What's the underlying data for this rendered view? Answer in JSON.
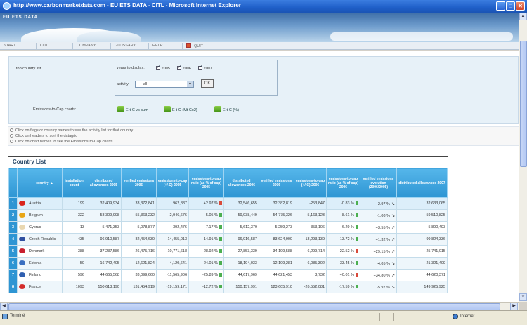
{
  "window": {
    "title": "http://www.carbonmarketdata.com - EU ETS DATA - CITL - Microsoft Internet Explorer",
    "minimize": "_",
    "maximize": "□",
    "close": "✕"
  },
  "banner": {
    "logo": "EU ETS DATA"
  },
  "menu": [
    "START",
    "CITL",
    "COMPANY",
    "GLOSSARY",
    "HELP",
    "QUIT"
  ],
  "filter": {
    "label": "top country list",
    "years_label": "years to display:",
    "years": [
      "2005",
      "2006",
      "2007"
    ],
    "activity_label": "activity",
    "activity_value": "---- all ----",
    "ok_label": "OK",
    "charts_label": "Emissions-to-Cap charts:",
    "chart_links": [
      "E-t-C vs sum",
      "E-t-C (Mt Co2)",
      "E-t-C (%)"
    ]
  },
  "hints": [
    "Click on flags or country names to see the activity list for that country",
    "Click on headers to sort the datagrid",
    "Click on chart names to see the Emissions-to-Cap charts"
  ],
  "section_title": "Country List",
  "table": {
    "headers": [
      "",
      "",
      "country ▲",
      "installation count",
      "distributed allowances 2005",
      "verified emissions 2005",
      "emissions-to-cap (+/-C) 2005",
      "emissions-to-cap ratio (as % of cap) 2005",
      "distributed allowances 2006",
      "verified emissions 2006",
      "emissions-to-cap (+/-C) 2006",
      "emissions-to-cap ratio (as % of cap) 2006",
      "verified emissions evolution (2006/2005)",
      "distributed allowances 2007"
    ],
    "rows": [
      {
        "rank": "1",
        "country": "Austria",
        "count": "199",
        "da05": "32,409,934",
        "ve05": "33,372,841",
        "etc05": "962,887",
        "r05": "+2.97 %",
        "da06": "32,546,655",
        "ve06": "32,382,819",
        "etc06": "-253,847",
        "r06": "-0.83 %",
        "evo": "-2.97 %",
        "evo_dir": "down",
        "da07": "32,633,065",
        "flag": "#d9241c",
        "r05c": "#d94a3a",
        "r06c": "#4caf50"
      },
      {
        "rank": "2",
        "country": "Belgium",
        "count": "322",
        "da05": "58,309,998",
        "ve05": "55,363,232",
        "etc05": "-2,946,676",
        "r05": "-5.05 %",
        "da06": "59,938,449",
        "ve06": "54,775,326",
        "etc06": "-5,163,123",
        "r06": "-8.61 %",
        "evo": "-1.08 %",
        "evo_dir": "down",
        "da07": "59,510,825",
        "flag": "#e8a515",
        "r05c": "#4caf50",
        "r06c": "#4caf50"
      },
      {
        "rank": "3",
        "country": "Cyprus",
        "count": "13",
        "da05": "5,471,353",
        "ve05": "5,078,877",
        "etc05": "-392,476",
        "r05": "-7.17 %",
        "da06": "5,612,379",
        "ve06": "5,259,273",
        "etc06": "-353,106",
        "r06": "-6.29 %",
        "evo": "+3.55 %",
        "evo_dir": "up",
        "da07": "5,890,493",
        "flag": "#e9d7b0",
        "r05c": "#4caf50",
        "r06c": "#4caf50"
      },
      {
        "rank": "4",
        "country": "Czech Republic",
        "count": "435",
        "da05": "96,910,587",
        "ve05": "82,454,630",
        "etc05": "-14,455,013",
        "r05": "-14.91 %",
        "da06": "96,916,587",
        "ve06": "83,624,900",
        "etc06": "-13,293,139",
        "r06": "-13.72 %",
        "evo": "+1.32 %",
        "evo_dir": "up",
        "da07": "99,824,336",
        "flag": "#2f4fa0",
        "r05c": "#4caf50",
        "r06c": "#4caf50"
      },
      {
        "rank": "5",
        "country": "Denmark",
        "count": "388",
        "da05": "37,237,586",
        "ve05": "26,475,716",
        "etc05": "-10,771,618",
        "r05": "-28.92 %",
        "da06": "27,853,339",
        "ve06": "34,199,588",
        "etc06": "6,299,714",
        "r06": "+22.52 %",
        "evo": "+29.15 %",
        "evo_dir": "up",
        "da07": "25,741,015",
        "flag": "#c8202f",
        "r05c": "#4caf50",
        "r06c": "#d94a3a"
      },
      {
        "rank": "6",
        "country": "Estonia",
        "count": "50",
        "da05": "16,742,405",
        "ve05": "12,621,824",
        "etc05": "-4,120,641",
        "r05": "-24.01 %",
        "da06": "18,194,033",
        "ve06": "12,109,281",
        "etc06": "-6,085,302",
        "r06": "-33.45 %",
        "evo": "-4.05 %",
        "evo_dir": "down",
        "da07": "21,321,409",
        "flag": "#3a6fc0",
        "r05c": "#4caf50",
        "r06c": "#4caf50"
      },
      {
        "rank": "7",
        "country": "Finland",
        "count": "596",
        "da05": "44,665,568",
        "ve05": "33,099,660",
        "etc05": "-11,565,906",
        "r05": "-25.89 %",
        "da06": "44,617,969",
        "ve06": "44,621,453",
        "etc06": "3,732",
        "r06": "+0.01 %",
        "evo": "+34.80 %",
        "evo_dir": "up",
        "da07": "44,620,371",
        "flag": "#2f5fb0",
        "r05c": "#4caf50",
        "r06c": "#d94a3a"
      },
      {
        "rank": "8",
        "country": "France",
        "count": "1093",
        "da05": "150,613,190",
        "ve05": "131,454,919",
        "etc05": "-19,159,171",
        "r05": "-12.72 %",
        "da06": "150,157,991",
        "ve06": "123,605,910",
        "etc06": "-26,552,081",
        "r06": "-17.59 %",
        "evo": "-5.97 %",
        "evo_dir": "down",
        "da07": "149,925,925",
        "flag": "#d42b2b",
        "r05c": "#4caf50",
        "r06c": "#4caf50"
      }
    ]
  },
  "status": {
    "text": "Terminé",
    "zone": "Internet"
  }
}
